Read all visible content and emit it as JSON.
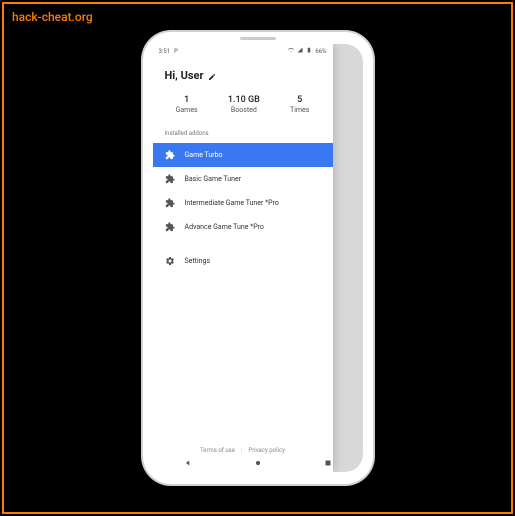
{
  "watermark": "hack-cheat.org",
  "status_bar": {
    "time": "3:51",
    "battery": "66%"
  },
  "greeting": "Hi, User",
  "stats": [
    {
      "value": "1",
      "label": "Games"
    },
    {
      "value": "1.10 GB",
      "label": "Boosted"
    },
    {
      "value": "5",
      "label": "Times"
    }
  ],
  "section_header": "Installed addons",
  "menu": [
    {
      "label": "Game Turbo",
      "icon": "puzzle",
      "active": true
    },
    {
      "label": "Basic Game Tuner",
      "icon": "puzzle",
      "active": false
    },
    {
      "label": "Intermediate Game Tuner *Pro",
      "icon": "puzzle",
      "active": false
    },
    {
      "label": "Advance Game Tune *Pro",
      "icon": "puzzle",
      "active": false
    }
  ],
  "settings_label": "Settings",
  "footer": {
    "terms": "Terms of use",
    "privacy": "Privacy policy"
  }
}
